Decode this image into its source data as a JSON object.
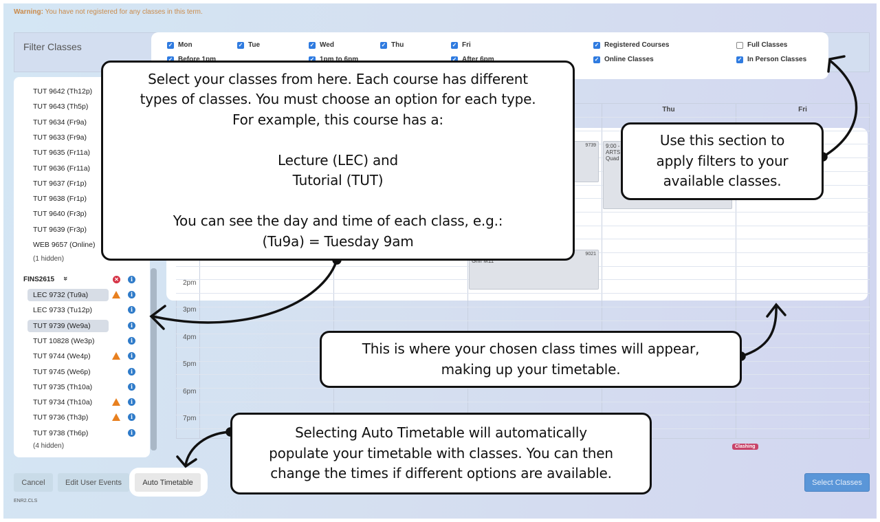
{
  "warning": {
    "label": "Warning:",
    "text": " You have not registered for any classes in this term."
  },
  "filter": {
    "title": "Filter Classes",
    "options": [
      {
        "label": "Mon",
        "checked": true
      },
      {
        "label": "Tue",
        "checked": true
      },
      {
        "label": "Wed",
        "checked": true
      },
      {
        "label": "Thu",
        "checked": true
      },
      {
        "label": "Fri",
        "checked": true
      },
      {
        "label": "Registered Courses",
        "checked": true
      },
      {
        "label": "Full Classes",
        "checked": false
      },
      {
        "label": "Before 1pm",
        "checked": true
      },
      {
        "label": "1pm to 6pm",
        "checked": true
      },
      {
        "label": "After 6pm",
        "checked": true
      },
      {
        "label": "Online Classes",
        "checked": true
      },
      {
        "label": "In Person Classes",
        "checked": true
      }
    ]
  },
  "sidebar": {
    "prev_items": [
      "TUT 9642 (Th12p)",
      "TUT 9643 (Th5p)",
      "TUT 9634 (Fr9a)",
      "TUT 9633 (Fr9a)",
      "TUT 9635 (Fr11a)",
      "TUT 9636 (Fr11a)",
      "TUT 9637 (Fr1p)",
      "TUT 9638 (Fr1p)",
      "TUT 9640 (Fr3p)",
      "TUT 9639 (Fr3p)",
      "WEB 9657 (Online)"
    ],
    "prev_hidden": "(1 hidden)",
    "course": "FINS2615",
    "items": [
      {
        "label": "LEC 9732 (Tu9a)",
        "selected": true,
        "warning": true
      },
      {
        "label": "LEC 9733 (Tu12p)",
        "selected": false,
        "warning": false
      },
      {
        "label": "TUT 9739 (We9a)",
        "selected": true,
        "warning": false
      },
      {
        "label": "TUT 10828 (We3p)",
        "selected": false,
        "warning": false
      },
      {
        "label": "TUT 9744 (We4p)",
        "selected": false,
        "warning": true
      },
      {
        "label": "TUT 9745 (We6p)",
        "selected": false,
        "warning": false
      },
      {
        "label": "TUT 9735 (Th10a)",
        "selected": false,
        "warning": false
      },
      {
        "label": "TUT 9734 (Th10a)",
        "selected": false,
        "warning": true
      },
      {
        "label": "TUT 9736 (Th3p)",
        "selected": false,
        "warning": true
      },
      {
        "label": "TUT 9738 (Th6p)",
        "selected": false,
        "warning": false
      }
    ],
    "hidden": "(4 hidden)"
  },
  "timetable": {
    "days": [
      "",
      "",
      "",
      "Thu",
      "Fri"
    ],
    "hours": [
      "2pm",
      "3pm",
      "4pm",
      "5pm",
      "6pm",
      "7pm"
    ],
    "events": [
      {
        "id": "9739",
        "lines": []
      },
      {
        "id": "",
        "lines": [
          "9:00 -",
          "ARTS",
          "Quad"
        ]
      },
      {
        "id": "9021",
        "lines": [
          "ARTS1011 - LEC",
          "Griff M11"
        ]
      }
    ]
  },
  "buttons": {
    "cancel": "Cancel",
    "edit": "Edit User Events",
    "auto": "Auto Timetable",
    "select": "Select Classes"
  },
  "clashing": "Clashing",
  "footer": "ENR2.CLS",
  "callouts": {
    "classes": [
      "Select your classes from here. Each course has different",
      "types of classes. You must choose an option for each type.",
      "For example, this course has a:",
      "",
      "Lecture (LEC) and",
      "Tutorial (TUT)",
      "",
      "You can see the day and time of each class, e.g.:",
      "(Tu9a) = Tuesday 9am"
    ],
    "filters": [
      "Use this section to",
      "apply filters to your",
      "available classes."
    ],
    "timetable": [
      "This is where your chosen class times will appear,",
      "making up your timetable."
    ],
    "auto": [
      "Selecting Auto Timetable will automatically",
      "populate your timetable with classes. You can then",
      "change the times if different options are available."
    ]
  },
  "colors": {
    "accent": "#2f7be0",
    "warning": "#e8801f",
    "error": "#d63447",
    "clashing": "#c8436a"
  }
}
